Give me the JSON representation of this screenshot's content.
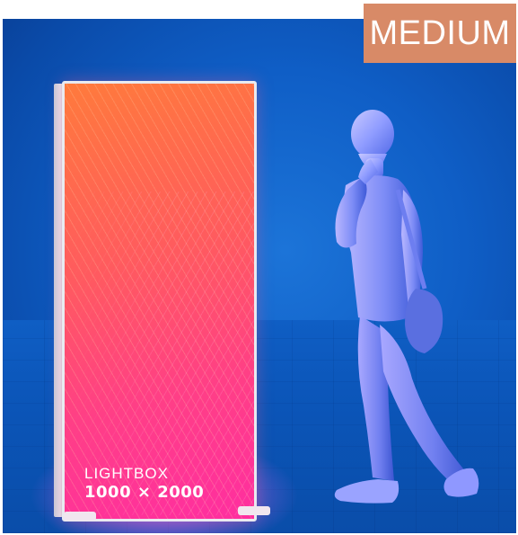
{
  "badge": {
    "label": "MEDIUM"
  },
  "lightbox": {
    "title": "LIGHTBOX",
    "size": "1000 × 2000"
  },
  "colors": {
    "background_blue": "#0f5ec6",
    "badge_bg": "#d88a67",
    "lightbox_orange": "#ff7a3c",
    "lightbox_pink": "#ff2ea0",
    "figure_light": "#a8b4ff"
  }
}
